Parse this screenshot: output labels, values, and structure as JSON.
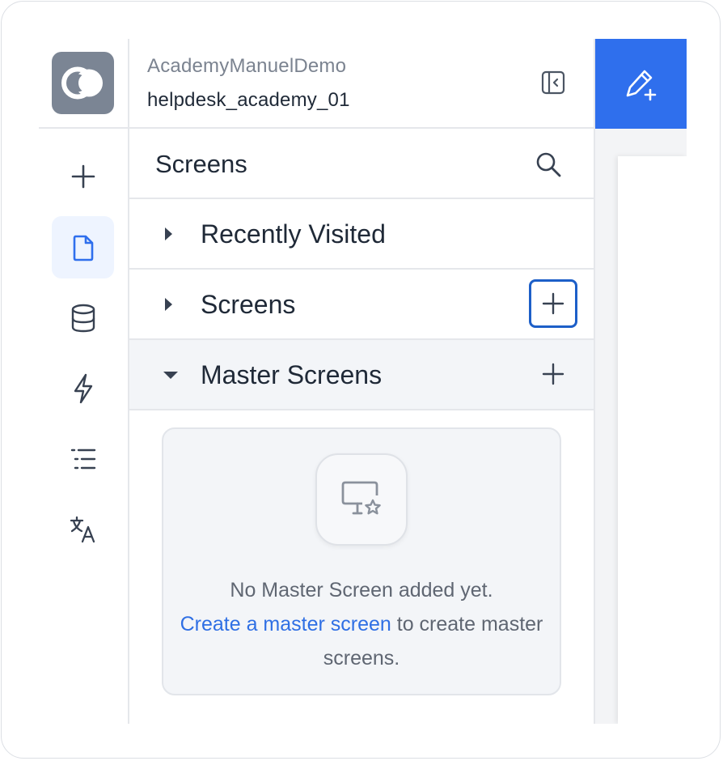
{
  "colors": {
    "accent": "#2f6fed",
    "link": "#2f6fe4",
    "focus_ring": "#1d5fc8",
    "logo_bg": "#7b8594",
    "active_rail_bg": "#eef4ff"
  },
  "rail": {
    "logo_icon": "app-logo",
    "items": [
      {
        "icon": "plus-icon",
        "active": false
      },
      {
        "icon": "file-icon",
        "active": true
      },
      {
        "icon": "database-icon",
        "active": false
      },
      {
        "icon": "lightning-icon",
        "active": false
      },
      {
        "icon": "list-icon",
        "active": false
      },
      {
        "icon": "translate-icon",
        "active": false
      }
    ]
  },
  "header": {
    "org_name": "AcademyManuelDemo",
    "app_name": "helpdesk_academy_01",
    "collapse_icon": "sidebar-collapse-icon"
  },
  "panel": {
    "title": "Screens",
    "search_icon": "search-icon",
    "sections": [
      {
        "label": "Recently Visited",
        "expanded": false,
        "has_add": false
      },
      {
        "label": "Screens",
        "expanded": false,
        "has_add": true
      },
      {
        "label": "Master Screens",
        "expanded": true,
        "has_add": true
      }
    ]
  },
  "empty_state": {
    "icon": "monitor-star-icon",
    "message": "No Master Screen added yet.",
    "link_text": "Create a master screen",
    "suffix": " to create master screens."
  },
  "toolbar": {
    "edit_icon": "edit-plus-icon"
  }
}
